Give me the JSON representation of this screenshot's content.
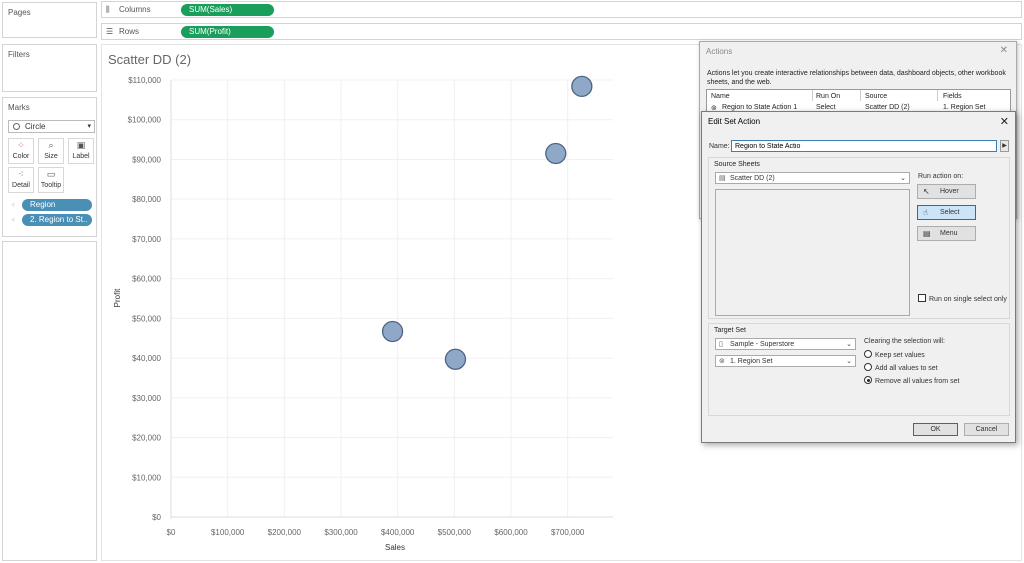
{
  "panes": {
    "pages": "Pages",
    "filters": "Filters",
    "marks": "Marks"
  },
  "marks": {
    "type": "Circle",
    "buttons": [
      "Color",
      "Size",
      "Label",
      "Detail",
      "Tooltip"
    ],
    "pills": [
      "Region",
      "2. Region to St.."
    ]
  },
  "shelves": {
    "columns_label": "Columns",
    "columns_pill": "SUM(Sales)",
    "rows_label": "Rows",
    "rows_pill": "SUM(Profit)"
  },
  "sheet_title": "Scatter DD (2)",
  "chart_data": {
    "type": "scatter",
    "xlabel": "Sales",
    "ylabel": "Profit",
    "xlim": [
      0,
      780000
    ],
    "ylim": [
      0,
      110000
    ],
    "x_ticks": [
      0,
      100000,
      200000,
      300000,
      400000,
      500000,
      600000,
      700000
    ],
    "x_tick_labels": [
      "$0",
      "$100,000",
      "$200,000",
      "$300,000",
      "$400,000",
      "$500,000",
      "$600,000",
      "$700,000"
    ],
    "y_ticks": [
      0,
      10000,
      20000,
      30000,
      40000,
      50000,
      60000,
      70000,
      80000,
      90000,
      100000,
      110000
    ],
    "y_tick_labels": [
      "$0",
      "$10,000",
      "$20,000",
      "$30,000",
      "$40,000",
      "$50,000",
      "$60,000",
      "$70,000",
      "$80,000",
      "$90,000",
      "$100,000",
      "$110,000"
    ],
    "points": [
      {
        "x": 725000,
        "y": 108400
      },
      {
        "x": 679000,
        "y": 91500
      },
      {
        "x": 391000,
        "y": 46700
      },
      {
        "x": 502000,
        "y": 39700
      }
    ],
    "grid": true,
    "colors": {
      "point_fill": "#8fa8c8",
      "point_stroke": "#4d6382"
    }
  },
  "actions_dialog": {
    "title": "Actions",
    "description": "Actions let you create interactive relationships between data, dashboard objects, other workbook sheets, and the web.",
    "columns": [
      "Name",
      "Run On",
      "Source",
      "Fields"
    ],
    "row": [
      "Region to State Action 1",
      "Select",
      "Scatter DD (2)",
      "1. Region Set"
    ]
  },
  "edit_dialog": {
    "title": "Edit Set Action",
    "name_label": "Name:",
    "name_value": "Region to State Actio",
    "source_sheets_label": "Source Sheets",
    "source_sheet": "Scatter DD (2)",
    "run_action_label": "Run action on:",
    "run_options": [
      "Hover",
      "Select",
      "Menu"
    ],
    "run_selected": "Select",
    "single_select_label": "Run on single select only",
    "target_set_label": "Target Set",
    "target_datasource": "Sample - Superstore",
    "target_set": "1. Region Set",
    "clearing_label": "Clearing the selection will:",
    "clear_options": [
      "Keep set values",
      "Add all values to set",
      "Remove all values from set"
    ],
    "clear_selected": "Remove all values from set",
    "ok_label": "OK",
    "cancel_label": "Cancel"
  }
}
